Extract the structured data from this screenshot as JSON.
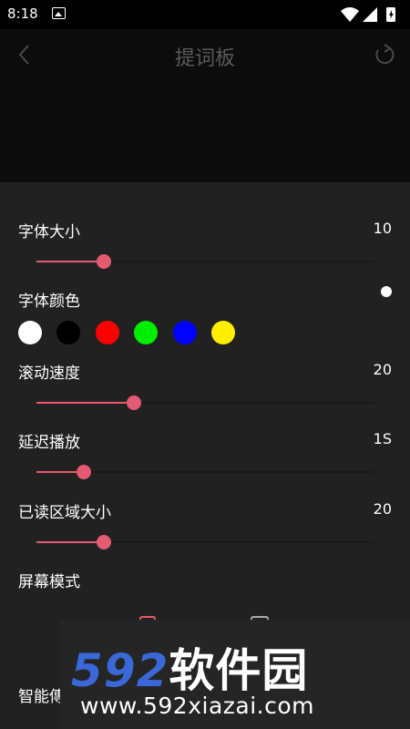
{
  "status": {
    "time": "8:18"
  },
  "header": {
    "title": "提词板"
  },
  "settings": {
    "font_size": {
      "label": "字体大小",
      "value": "10",
      "level": 0.2
    },
    "font_color": {
      "label": "字体颜色",
      "swatches": [
        "#ffffff",
        "#000000",
        "#ff0000",
        "#00ee00",
        "#0000ff",
        "#ffee00"
      ]
    },
    "scroll_speed": {
      "label": "滚动速度",
      "value": "20",
      "level": 0.29
    },
    "delay_play": {
      "label": "延迟播放",
      "value": "1S",
      "level": 0.14
    },
    "read_area": {
      "label": "已读区域大小",
      "value": "20",
      "level": 0.2
    },
    "screen_mode": {
      "label": "屏幕模式"
    },
    "smart": {
      "label": "智能傳"
    }
  },
  "colors": {
    "accent": "#e35a72",
    "panel": "#212121",
    "background": "#0c0c0c"
  },
  "watermark": {
    "brand_num": "592",
    "brand_cn": "软件园",
    "url": "www.592xiazai.com"
  }
}
